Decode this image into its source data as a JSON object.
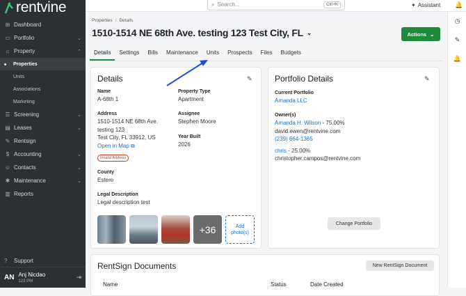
{
  "app": {
    "logo_text": "rentvine"
  },
  "sidebar": {
    "items": [
      {
        "label": "Dashboard",
        "icon": "dashboard-icon"
      },
      {
        "label": "Portfolio",
        "icon": "folder-icon",
        "chevron": true
      },
      {
        "label": "Property",
        "icon": "property-icon",
        "chevron": true
      }
    ],
    "property_sub": [
      "Properties",
      "Units",
      "Associations",
      "Marketing"
    ],
    "items2": [
      {
        "label": "Screening",
        "icon": "screening-icon",
        "chevron": true
      },
      {
        "label": "Leases",
        "icon": "leases-icon",
        "chevron": true
      },
      {
        "label": "Rentsign",
        "icon": "rentsign-icon"
      },
      {
        "label": "Accounting",
        "icon": "accounting-icon",
        "chevron": true
      },
      {
        "label": "Contacts",
        "icon": "contacts-icon",
        "chevron": true
      },
      {
        "label": "Maintenance",
        "icon": "maintenance-icon",
        "chevron": true
      },
      {
        "label": "Reports",
        "icon": "reports-icon"
      }
    ],
    "support": "Support",
    "user": {
      "initials": "AN",
      "name": "Anj Nicdao",
      "time": "123 PM"
    }
  },
  "topbar": {
    "search_placeholder": "Search...",
    "shortcut": "Ctrl+K",
    "assistant": "Assistant"
  },
  "breadcrumb": [
    "Properties",
    "Details"
  ],
  "page_title": "1510-1514 NE 68th Ave. testing 123 Test City, FL",
  "actions_label": "Actions",
  "tabs": [
    "Details",
    "Settings",
    "Bills",
    "Maintenance",
    "Units",
    "Prospects",
    "Files",
    "Budgets"
  ],
  "details": {
    "title": "Details",
    "name_label": "Name",
    "name": "A-68th 1",
    "type_label": "Property Type",
    "type": "Apartment",
    "address_label": "Address",
    "address1": "1510-1514 NE 68th Ave.",
    "address2": "testing 123",
    "address3": "Test City, FL 33912, US",
    "map_link": "Open in Map",
    "invalid_badge": "Invalid Address",
    "assignee_label": "Assignee",
    "assignee": "Stephen Moore",
    "year_label": "Year Built",
    "year": "2026",
    "county_label": "County",
    "county": "Estero",
    "legal_label": "Legal Description",
    "legal": "Legal description test",
    "more_photos": "+36",
    "add_photo": "Add photo(s)"
  },
  "portfolio": {
    "title": "Portfolio Details",
    "current_label": "Current Portfolio",
    "current": "Amanda LLC",
    "owners_label": "Owner(s)",
    "owner1_name": "Amanda H. Wilson",
    "owner1_pct": "- 75.00%",
    "owner1_email": "david.ewen@rentvine.com",
    "owner1_phone": "(239) 664-1365",
    "owner2_name": "chris",
    "owner2_pct": "- 25.00%",
    "owner2_email": "christopher.campos@rentvine.com",
    "change_btn": "Change Portfolio"
  },
  "rentsign": {
    "title": "RentSign Documents",
    "new_btn": "New RentSign Document",
    "columns": [
      "Name",
      "Status",
      "Date Created"
    ]
  },
  "colors": {
    "accent": "#1e8a3c",
    "link": "#1a6fc4",
    "sidebar_bg": "#2c2f33",
    "arrow": "#1f4fd8"
  }
}
